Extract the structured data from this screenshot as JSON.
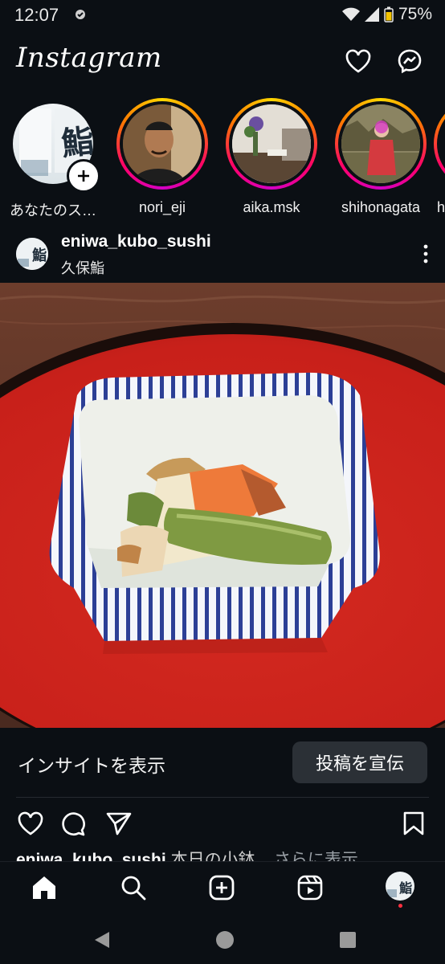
{
  "status": {
    "time": "12:07",
    "battery": "75%"
  },
  "header": {
    "logo": "Instagram"
  },
  "stories": [
    {
      "label": "あなたのス…"
    },
    {
      "label": "nori_eji"
    },
    {
      "label": "aika.msk"
    },
    {
      "label": "shihonagata"
    },
    {
      "label": "h"
    }
  ],
  "post": {
    "username": "eniwa_kubo_sushi",
    "location": "久保鮨",
    "insights_label": "インサイトを表示",
    "promote_label": "投稿を宣伝",
    "caption_user": "eniwa_kubo_sushi",
    "caption_text": "本日の小鉢...",
    "caption_more": "さらに表示"
  },
  "colors": {
    "background": "#0b0f14",
    "story_ring": "#ff0069",
    "button_bg": "#2b3036",
    "notification_dot": "#ff3040"
  },
  "icons": [
    "heart-icon",
    "messenger-icon",
    "add-story-icon",
    "more-options-icon",
    "like-icon",
    "comment-icon",
    "share-icon",
    "save-icon",
    "home-icon",
    "search-icon",
    "create-icon",
    "reels-icon",
    "profile-icon"
  ]
}
